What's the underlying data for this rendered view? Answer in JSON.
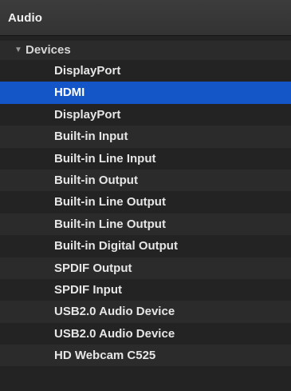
{
  "window": {
    "title": "Audio"
  },
  "tree": {
    "group": {
      "label": "Devices",
      "icon": "disclosure-triangle-down-icon",
      "icon_glyph": "▼"
    },
    "selected_color": "#1456c7",
    "items": [
      {
        "label": "DisplayPort",
        "selected": false
      },
      {
        "label": "HDMI",
        "selected": true
      },
      {
        "label": "DisplayPort",
        "selected": false
      },
      {
        "label": "Built-in Input",
        "selected": false
      },
      {
        "label": "Built-in Line Input",
        "selected": false
      },
      {
        "label": "Built-in Output",
        "selected": false
      },
      {
        "label": "Built-in Line Output",
        "selected": false
      },
      {
        "label": "Built-in Line Output",
        "selected": false
      },
      {
        "label": "Built-in Digital Output",
        "selected": false
      },
      {
        "label": "SPDIF Output",
        "selected": false
      },
      {
        "label": "SPDIF Input",
        "selected": false
      },
      {
        "label": "USB2.0 Audio Device",
        "selected": false
      },
      {
        "label": "USB2.0 Audio Device",
        "selected": false
      },
      {
        "label": "HD Webcam C525",
        "selected": false
      }
    ]
  }
}
